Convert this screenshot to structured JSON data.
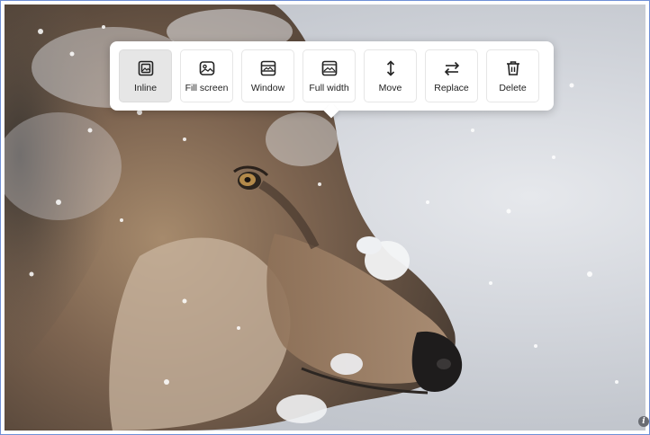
{
  "image": {
    "subject": "wolf",
    "background_color": "#c9ccd2"
  },
  "toolbar": {
    "buttons": [
      {
        "label": "Inline",
        "icon": "image-inline-icon",
        "active": true
      },
      {
        "label": "Fill screen",
        "icon": "image-fill-icon",
        "active": false
      },
      {
        "label": "Window",
        "icon": "image-window-icon",
        "active": false
      },
      {
        "label": "Full width",
        "icon": "image-full-width-icon",
        "active": false
      },
      {
        "label": "Move",
        "icon": "move-vertical-icon",
        "active": false
      },
      {
        "label": "Replace",
        "icon": "swap-arrows-icon",
        "active": false
      },
      {
        "label": "Delete",
        "icon": "trash-icon",
        "active": false
      }
    ]
  },
  "info": {
    "icon": "info-icon",
    "glyph": "i"
  }
}
